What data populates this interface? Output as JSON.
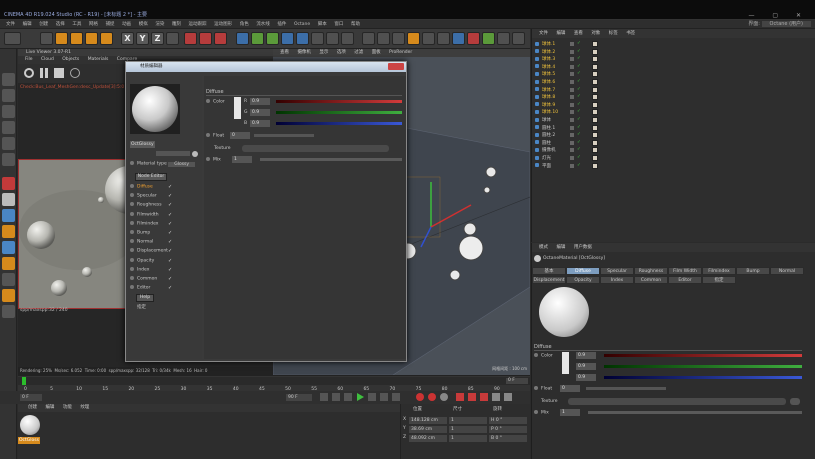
{
  "window": {
    "title": "CINEMA 4D R19.024 Studio (RC - R19) - [未标题 2 *] - 主要"
  },
  "menubar": {
    "items": [
      "文件",
      "编辑",
      "创建",
      "选择",
      "工具",
      "网格",
      "捕捉",
      "动画",
      "模拟",
      "渲染",
      "雕刻",
      "运动跟踪",
      "运动图形",
      "角色",
      "流水线",
      "插件",
      "Octane",
      "脚本",
      "窗口",
      "帮助"
    ],
    "layout_label": "界面:",
    "layout_value": "Octane (用户)"
  },
  "toolbar": {
    "x_label": "X",
    "y_label": "Y",
    "z_label": "Z"
  },
  "live_viewer": {
    "caption": "Live Viewer 3.07-R1",
    "menu": [
      "File",
      "Cloud",
      "Objects",
      "Materials",
      "Compare",
      "Options",
      "Help",
      "Gui"
    ],
    "error_text": "Check:Bus_Leaf_MeshGen:desc_Update[3]:5:0",
    "spp_text": "spp/maxspp:32 / 240",
    "status": [
      "Rendering: 25%",
      "Ms/sec: 6.052",
      "Time: 0:00",
      "spp/maxspp: 32/128",
      "Tri: 0/34k",
      "Mesh: 16",
      "Hair: 0"
    ]
  },
  "viewport": {
    "menu": [
      "查看",
      "摄像机",
      "显示",
      "选项",
      "过滤",
      "面板",
      "ProRender"
    ],
    "grid_info": "网格间距 : 100 cm"
  },
  "material_editor": {
    "title": "材质编辑器",
    "material_name": "OctGlossy",
    "material_type_label": "Material type",
    "material_type_value": "Glossy",
    "node_editor_label": "Node Editor",
    "channels": [
      {
        "label": "Diffuse",
        "checked": true,
        "active": true
      },
      {
        "label": "Specular",
        "checked": true,
        "active": false
      },
      {
        "label": "Roughness",
        "checked": true,
        "active": false
      },
      {
        "label": "Filmwidth",
        "checked": true,
        "active": false
      },
      {
        "label": "Filmindex",
        "checked": true,
        "active": false
      },
      {
        "label": "Bump",
        "checked": true,
        "active": false
      },
      {
        "label": "Normal",
        "checked": true,
        "active": false
      },
      {
        "label": "Displacement",
        "checked": true,
        "active": false
      },
      {
        "label": "Opacity",
        "checked": true,
        "active": false
      },
      {
        "label": "Index",
        "checked": true,
        "active": false
      },
      {
        "label": "Common",
        "checked": true,
        "active": false
      },
      {
        "label": "Editor",
        "checked": true,
        "active": false
      }
    ],
    "help_label": "Help",
    "assign_label": "指定",
    "section_title": "Diffuse",
    "color_label": "Color",
    "r_label": "R",
    "g_label": "G",
    "b_label": "B",
    "r_value": "0.9",
    "g_value": "0.9",
    "b_value": "0.9",
    "float_label": "Float",
    "float_value": "0",
    "texture_label": "Texture",
    "mix_label": "Mix",
    "mix_value": "1"
  },
  "object_manager": {
    "menu": [
      "文件",
      "编辑",
      "查看",
      "对象",
      "标签",
      "书签"
    ],
    "objects": [
      {
        "name": "球体.1",
        "selected": true
      },
      {
        "name": "球体.2",
        "selected": true
      },
      {
        "name": "球体.3",
        "selected": true
      },
      {
        "name": "球体.4",
        "selected": true
      },
      {
        "name": "球体.5",
        "selected": true
      },
      {
        "name": "球体.6",
        "selected": true
      },
      {
        "name": "球体.7",
        "selected": true
      },
      {
        "name": "球体.8",
        "selected": true
      },
      {
        "name": "球体.9",
        "selected": true
      },
      {
        "name": "球体.10",
        "selected": true
      },
      {
        "name": "球体",
        "selected": false
      },
      {
        "name": "圆柱.1",
        "selected": false
      },
      {
        "name": "圆柱.2",
        "selected": false
      },
      {
        "name": "圆柱",
        "selected": false
      },
      {
        "name": "摄像机",
        "selected": false
      },
      {
        "name": "灯光",
        "selected": false
      },
      {
        "name": "平面",
        "selected": false
      }
    ]
  },
  "attribute_manager": {
    "menu": [
      "模式",
      "编辑",
      "用户数据"
    ],
    "material_title": "OctaneMaterial [OctGlossy]",
    "tabs_row1": [
      "基本",
      "Diffuse",
      "Specular",
      "Roughness",
      "Film Width",
      "Filmindex",
      "Bump",
      "Normal"
    ],
    "tabs_row2": [
      "Displacement",
      "Opacity",
      "Index",
      "Common",
      "Editor",
      "指定"
    ],
    "section_title": "Diffuse",
    "color_label": "Color",
    "r_value": "0.9",
    "g_value": "0.9",
    "b_value": "0.9",
    "float_label": "Float",
    "float_value": "0",
    "texture_label": "Texture",
    "mix_label": "Mix",
    "mix_value": "1"
  },
  "timeline": {
    "ticks": [
      "0",
      "5",
      "10",
      "15",
      "20",
      "25",
      "30",
      "35",
      "40",
      "45",
      "50",
      "55",
      "60",
      "65",
      "70",
      "75",
      "80",
      "85",
      "90"
    ],
    "current_frame": "0 F",
    "start_field": "0 F",
    "end_field": "90 F",
    "right_field": "0 F"
  },
  "material_manager": {
    "menu": [
      "创建",
      "编辑",
      "功能",
      "纹理"
    ],
    "material_label": "OctGloss"
  },
  "coordinates": {
    "headers": [
      "位置",
      "尺寸",
      "旋转"
    ],
    "rows": [
      {
        "axis": "X",
        "pos": "148.128 cm",
        "size": "1",
        "rot": "H 0 °"
      },
      {
        "axis": "Y",
        "pos": "38.69 cm",
        "size": "1",
        "rot": "P 0 °"
      },
      {
        "axis": "Z",
        "pos": "48.092 cm",
        "size": "1",
        "rot": "B 0 °"
      }
    ]
  },
  "colors": {
    "accent_orange": "#f0a030",
    "selection_blue": "#7d9dbf",
    "red_slider": "#d23b3b",
    "green_slider": "#3fae3f",
    "blue_slider": "#3a58d6"
  }
}
